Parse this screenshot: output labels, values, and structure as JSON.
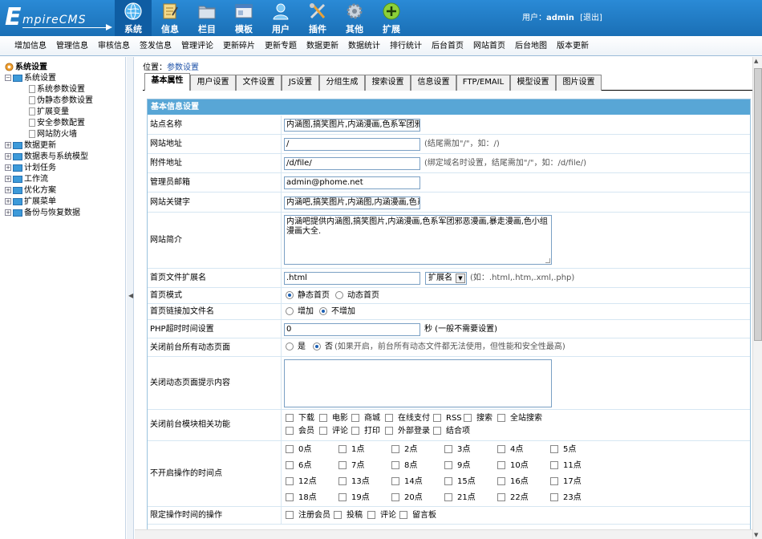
{
  "brand": {
    "logo_big": "E",
    "logo_rest": "mpireCMS"
  },
  "colors": {
    "topbar": "#1a6fb5",
    "active_tab": "#0f5da3",
    "form_header": "#58a6d6",
    "menu_bg": "#eef3f8"
  },
  "nav": [
    {
      "label": "系统",
      "icon": "globe-icon",
      "active": true
    },
    {
      "label": "信息",
      "icon": "notepad-icon"
    },
    {
      "label": "栏目",
      "icon": "folder-icon"
    },
    {
      "label": "模板",
      "icon": "window-icon"
    },
    {
      "label": "用户",
      "icon": "user-icon"
    },
    {
      "label": "插件",
      "icon": "tools-icon"
    },
    {
      "label": "其他",
      "icon": "gear-icon"
    },
    {
      "label": "扩展",
      "icon": "plus-icon"
    }
  ],
  "user": {
    "prefix": "用户：",
    "name": "admin",
    "logout": "[退出]"
  },
  "menu": [
    "增加信息",
    "管理信息",
    "审核信息",
    "签发信息",
    "管理评论",
    "更新碎片",
    "更新专题",
    "数据更新",
    "数据统计",
    "排行统计",
    "后台首页",
    "网站首页",
    "后台地图",
    "版本更新"
  ],
  "tree": {
    "root": "系统设置",
    "system": "系统设置",
    "system_children": [
      "系统参数设置",
      "伪静态参数设置",
      "扩展变量",
      "安全参数配置",
      "网站防火墙"
    ],
    "others": [
      "数据更新",
      "数据表与系统模型",
      "计划任务",
      "工作流",
      "优化方案",
      "扩展菜单",
      "备份与恢复数据"
    ]
  },
  "breadcrumb": {
    "prefix": "位置：",
    "link": "参数设置"
  },
  "tabs": [
    "基本属性",
    "用户设置",
    "文件设置",
    "JS设置",
    "分组生成",
    "搜索设置",
    "信息设置",
    "FTP/EMAIL",
    "模型设置",
    "图片设置"
  ],
  "form": {
    "header": "基本信息设置",
    "site_name": {
      "label": "站点名称",
      "value": "内涵图,搞笑图片,内涵漫画,色系军团邪恶"
    },
    "site_url": {
      "label": "网站地址",
      "value": "/",
      "hint": "(结尾需加\"/\"，如：/)"
    },
    "attach_url": {
      "label": "附件地址",
      "value": "/d/file/",
      "hint": "(绑定域名时设置，结尾需加\"/\"，如：/d/file/)"
    },
    "admin_email": {
      "label": "管理员邮箱",
      "value": "admin@phome.net"
    },
    "keywords": {
      "label": "网站关键字",
      "value": "内涵吧,搞笑图片,内涵图,内涵漫画,色系"
    },
    "intro": {
      "label": "网站简介",
      "value": "内涵吧提供内涵图,搞笑图片,内涵漫画,色系军团邪恶漫画,暴走漫画,色小组漫画大全."
    },
    "index_ext": {
      "label": "首页文件扩展名",
      "value": ".html",
      "select": "扩展名",
      "hint": "(如：.html,.htm,.xml,.php)"
    },
    "index_mode": {
      "label": "首页模式",
      "opt1": "静态首页",
      "opt2": "动态首页"
    },
    "index_link": {
      "label": "首页链接加文件名",
      "opt1": "增加",
      "opt2": "不增加"
    },
    "php_timeout": {
      "label": "PHP超时时间设置",
      "value": "0",
      "hint": "秒 (一般不需要设置)"
    },
    "close_dynamic": {
      "label": "关闭前台所有动态页面",
      "opt1": "是",
      "opt2": "否",
      "hint": "(如果开启，前台所有动态文件都无法使用，但性能和安全性最高)"
    },
    "close_msg": {
      "label": "关闭动态页面提示内容",
      "value": ""
    },
    "close_modules": {
      "label": "关闭前台模块相关功能",
      "row1": [
        "下载",
        "电影",
        "商城",
        "在线支付",
        "RSS",
        "搜索",
        "全站搜索"
      ],
      "row2": [
        "会员",
        "评论",
        "打印",
        "外部登录",
        "结合项"
      ]
    },
    "off_hours": {
      "label": "不开启操作的时间点",
      "hours": [
        "0点",
        "1点",
        "2点",
        "3点",
        "4点",
        "5点",
        "6点",
        "7点",
        "8点",
        "9点",
        "10点",
        "11点",
        "12点",
        "13点",
        "14点",
        "15点",
        "16点",
        "17点",
        "18点",
        "19点",
        "20点",
        "21点",
        "22点",
        "23点"
      ]
    },
    "limit_ops": {
      "label": "限定操作时间的操作",
      "opts": [
        "注册会员",
        "投稿",
        "评论",
        "留言板"
      ]
    }
  }
}
